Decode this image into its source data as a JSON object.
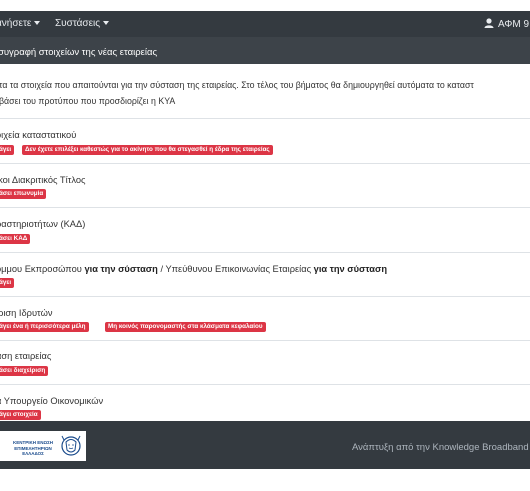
{
  "navbar": {
    "items": [
      {
        "label": "ανήσετε"
      },
      {
        "label": "Συστάσεις"
      }
    ],
    "user_label": "ΑΦΜ 9"
  },
  "header": {
    "title": "συγραφή στοιχείων της νέας εταιρείας"
  },
  "intro": {
    "line1": "τα τα στοιχεία που απαιτούνται για την σύσταση της εταιρείας. Στο τέλος του βήματος θα δημιουργηθεί αυτόματα το καταστ",
    "line2": "βάσει του προτύπου που προσδιορίζει η ΚΥΑ"
  },
  "sections": [
    {
      "title": "οιχεία καταστατικού",
      "badges": [
        "άγει",
        "Δεν έχετε επιλέξει καθεστώς για το ακίνητο που θα στεγασθεί η έδρα της εταιρείας"
      ]
    },
    {
      "title": "ικοι Διακριτικός Τίτλος",
      "badges": [
        "άσει επωνυμία"
      ]
    },
    {
      "title": "ραστηριοτήτων (ΚΑΔ)",
      "badges": [
        "άσει ΚΑΔ"
      ]
    },
    {
      "title_parts": [
        "όμμου Εκπροσώπου ",
        "για την σύσταση",
        " / Υπεύθυνου Επικοινωνίας Εταιρείας ",
        "για την σύσταση"
      ],
      "badges": [
        "άγει"
      ]
    },
    {
      "title": "ιριση Ιδρυτών",
      "badges": [
        "άγει ένα ή περισσότερα μέλη",
        "Μη κοινός παρονομαστής στα κλάσματα κεφαλαίου"
      ]
    },
    {
      "title": "αση εταιρείας",
      "badges": [
        "άσει διαχείριση"
      ]
    },
    {
      "title": "α Υπουργείο Οικονομικών",
      "badges": [
        "άγει στοιχεία"
      ]
    }
  ],
  "footer": {
    "logo_text": [
      "ΚΕΝΤΡΙΚΗ ΕΝΩΣΗ",
      "ΕΠΙΜΕΛΗΤΗΡΙΩΝ",
      "ΕΛΛΑΔΟΣ"
    ],
    "credit": "Ανάπτυξη από την  Knowledge Broadband"
  },
  "colors": {
    "navbar": "#343a40",
    "badge": "#dc3545",
    "divider": "#dee2e6"
  }
}
